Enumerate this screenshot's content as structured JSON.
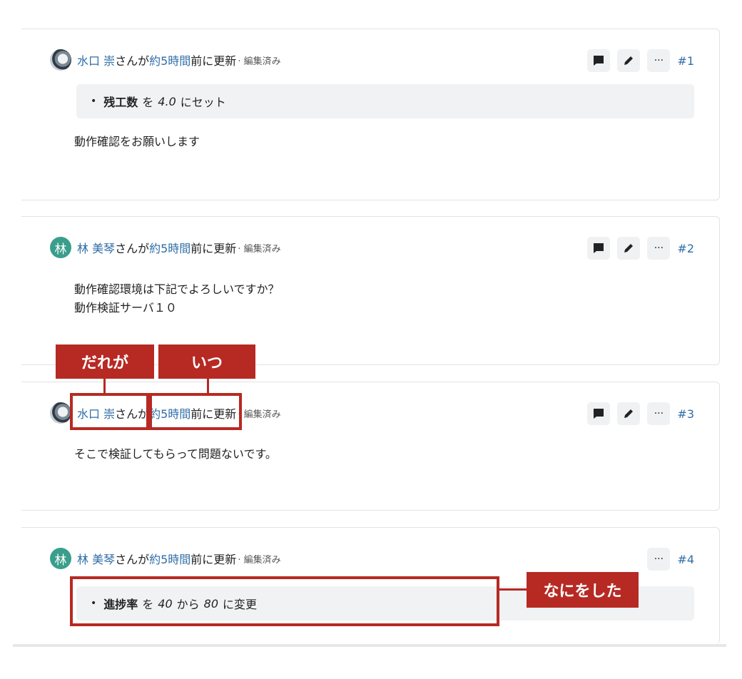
{
  "comments": [
    {
      "author": "水口 崇",
      "by": "さんが",
      "time": "約5時間",
      "updated": "前に更新",
      "edited": "· 編集済み",
      "number": "#1",
      "change": {
        "field": "残工数",
        "w1": "を",
        "value": "4.0",
        "w2": "にセット"
      },
      "body": [
        "動作確認をお願いします"
      ]
    },
    {
      "author_initial": "林",
      "author": "林 美琴",
      "by": "さんが",
      "time": "約5時間",
      "updated": "前に更新",
      "edited": "· 編集済み",
      "number": "#2",
      "body": [
        "動作確認環境は下記でよろしいですか？",
        "動作検証サーバ１０"
      ]
    },
    {
      "author": "水口 崇",
      "by": "さんが",
      "time": "約5時間",
      "updated": "前に更新",
      "edited": "· 編集済み",
      "number": "#3",
      "body": [
        "そこで検証してもらって問題ないです。"
      ]
    },
    {
      "author_initial": "林",
      "author": "林 美琴",
      "by": "さんが",
      "time": "約5時間",
      "updated": "前に更新",
      "edited": "· 編集済み",
      "number": "#4",
      "change": {
        "field": "進捗率",
        "w1": "を",
        "from": "40",
        "w2": "から",
        "to": "80",
        "w3": "に変更"
      }
    }
  ],
  "icons": {
    "comment": "comment-icon",
    "edit": "pencil-icon",
    "more": "more-icon"
  },
  "more_glyph": "···",
  "annotations": {
    "who": "だれが",
    "when": "いつ",
    "what": "なにをした"
  },
  "colors": {
    "accent": "#b62a23",
    "link": "#2f6ea6",
    "avatar_bg": "#3a9e8c"
  }
}
